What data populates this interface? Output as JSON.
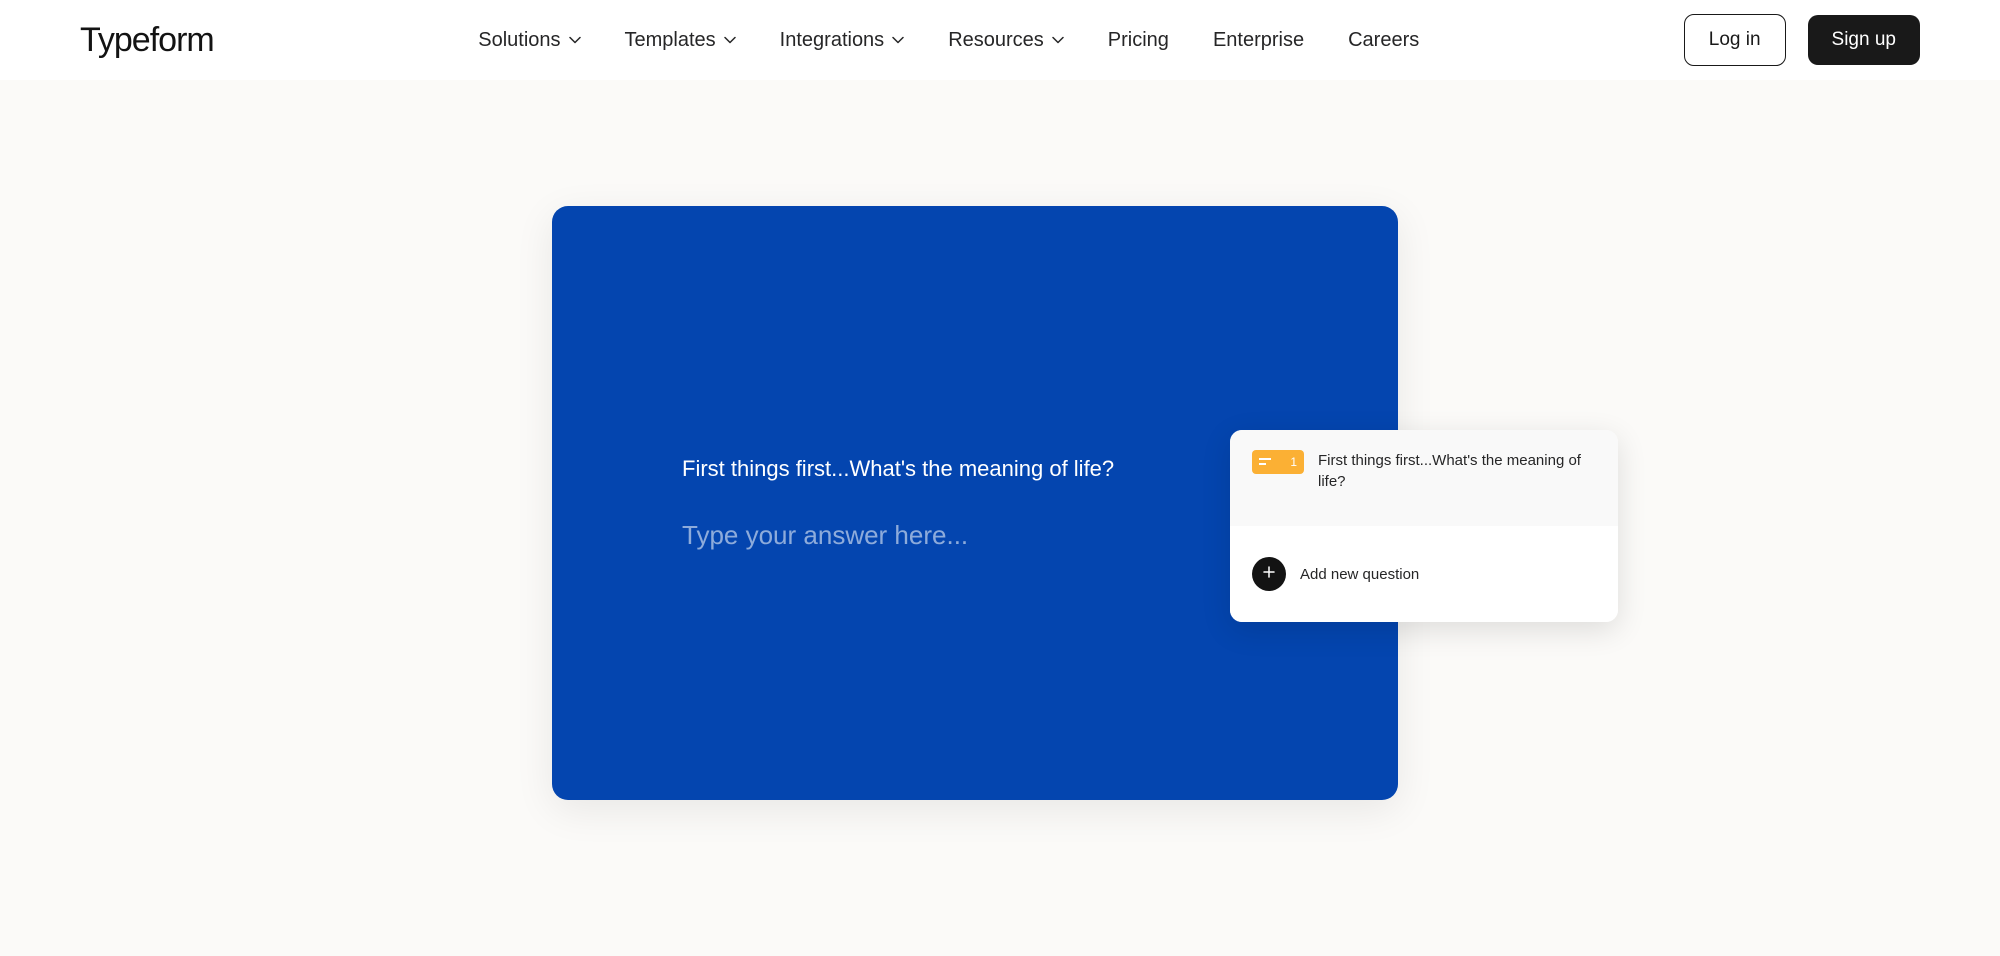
{
  "header": {
    "logo": "Typeform",
    "nav": [
      {
        "label": "Solutions",
        "hasDropdown": true
      },
      {
        "label": "Templates",
        "hasDropdown": true
      },
      {
        "label": "Integrations",
        "hasDropdown": true
      },
      {
        "label": "Resources",
        "hasDropdown": true
      },
      {
        "label": "Pricing",
        "hasDropdown": false
      },
      {
        "label": "Enterprise",
        "hasDropdown": false
      },
      {
        "label": "Careers",
        "hasDropdown": false
      }
    ],
    "login_label": "Log in",
    "signup_label": "Sign up"
  },
  "form": {
    "question": "First things first...What's the meaning of life?",
    "answer_placeholder": "Type your answer here..."
  },
  "panel": {
    "question_number": "1",
    "question_text": "First things first...What's the meaning of life?",
    "add_question_label": "Add new question"
  }
}
